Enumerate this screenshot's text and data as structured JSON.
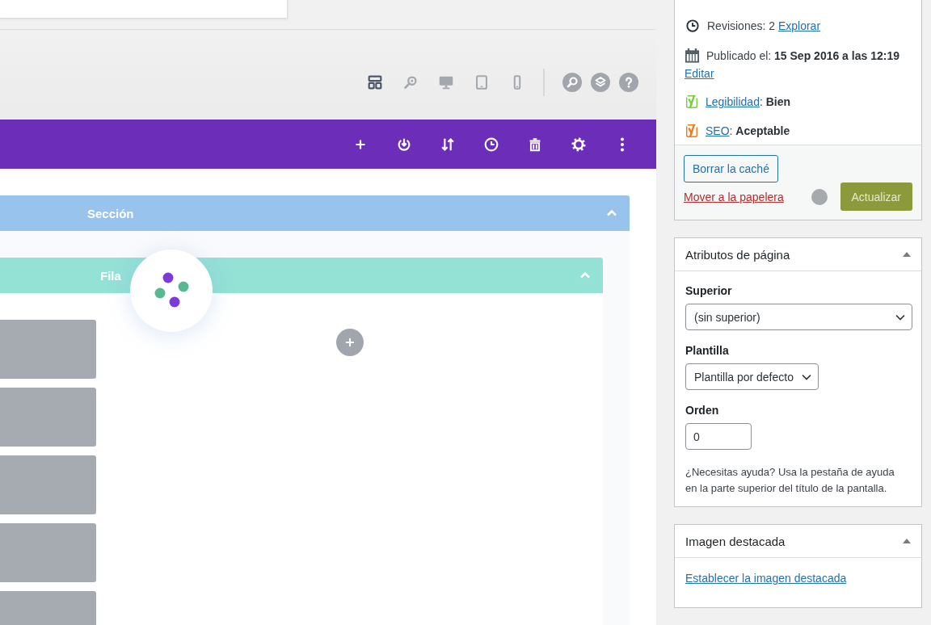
{
  "toolbar": {
    "view_modes": [
      {
        "kind": "wireframe",
        "selected": true
      },
      {
        "kind": "zoom",
        "selected": false
      },
      {
        "kind": "desktop",
        "selected": false
      },
      {
        "kind": "tablet",
        "selected": false
      },
      {
        "kind": "phone",
        "selected": false
      }
    ],
    "round_buttons": [
      {
        "kind": "search"
      },
      {
        "kind": "layers"
      },
      {
        "kind": "help"
      }
    ]
  },
  "page_bar": {
    "actions": [
      {
        "kind": "add"
      },
      {
        "kind": "power"
      },
      {
        "kind": "sort"
      },
      {
        "kind": "history"
      },
      {
        "kind": "trash"
      },
      {
        "kind": "settings"
      },
      {
        "kind": "more"
      }
    ]
  },
  "canvas": {
    "section": {
      "label": "Sección",
      "expanded": true,
      "row": {
        "label": "Fila",
        "expanded": true,
        "modules": [
          {
            "kind": "placeholder"
          },
          {
            "kind": "placeholder"
          },
          {
            "kind": "placeholder"
          },
          {
            "kind": "placeholder"
          },
          {
            "kind": "placeholder"
          }
        ]
      }
    },
    "loading": true
  },
  "publish_box": {
    "rows": [
      {
        "kind": "revisions",
        "label": "Revisiones: 2",
        "link": "Explorar"
      },
      {
        "kind": "published",
        "label": "Publicado el: **15 Sep 2016 a las 12:19**",
        "link": "Editar"
      },
      {
        "kind": "score",
        "link": "Legibilidad",
        "value": ": **Bien**",
        "color": "#7ad03a"
      },
      {
        "kind": "score",
        "link": "SEO",
        "value": ": **Aceptable**",
        "color": "#ee7c1b"
      }
    ],
    "clear_cache_button": "Borrar la caché",
    "trash_link": "Mover a la papelera",
    "saving": true,
    "update_button": "Actualizar"
  },
  "page_attributes": {
    "title": "Atributos de página",
    "expanded": true,
    "fields": [
      {
        "kind": "select",
        "label": "Superior",
        "value": "(sin superior)"
      },
      {
        "kind": "select",
        "label": "Plantilla",
        "value": "Plantilla por defecto"
      },
      {
        "kind": "number",
        "label": "Orden",
        "value": "0"
      }
    ],
    "help": "¿Necesitas ayuda? Usa la pestaña de ayuda en la parte superior del título de la pantalla."
  },
  "featured_image": {
    "title": "Imagen destacada",
    "expanded": true,
    "link": "Establecer la imagen destacada"
  }
}
